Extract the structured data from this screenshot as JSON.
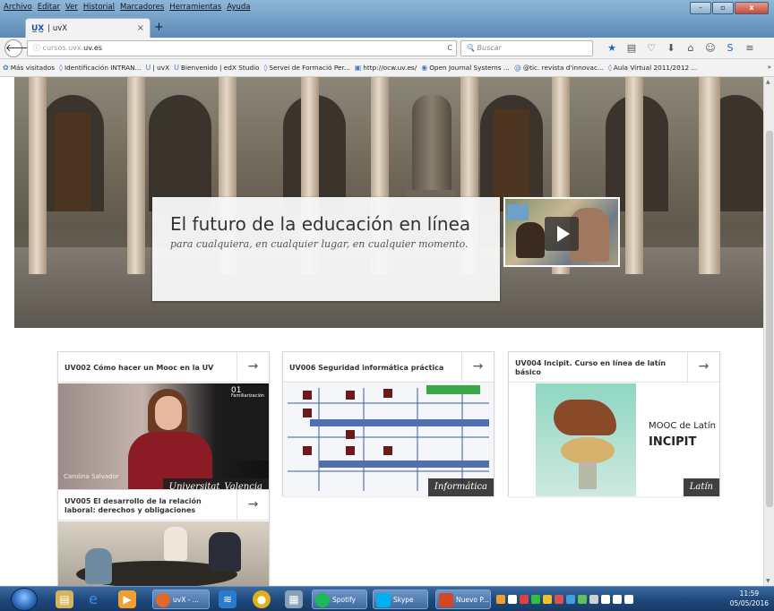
{
  "window": {
    "menus": [
      "Archivo",
      "Editar",
      "Ver",
      "Historial",
      "Marcadores",
      "Herramientas",
      "Ayuda"
    ],
    "controls": {
      "minimize": "–",
      "maximize": "▫",
      "close": "x"
    }
  },
  "tab": {
    "favicon_text": "U̲X̲",
    "label": "| uvX",
    "close": "×",
    "new_tab": "+"
  },
  "navbar": {
    "url_prefix": "cursos.uvx.",
    "url_domain": "uv.es",
    "search_placeholder": "Buscar",
    "reload": "C"
  },
  "bookmarks": [
    {
      "label": "Más visitados",
      "icon": "✿"
    },
    {
      "label": "Identificación INTRAN...",
      "icon": "◊"
    },
    {
      "label": "| uvX",
      "icon": "U"
    },
    {
      "label": "Bienvenido | edX Studio",
      "icon": "U"
    },
    {
      "label": "Servei de Formació Per...",
      "icon": "◊"
    },
    {
      "label": "http://ocw.uv.es/",
      "icon": "▣"
    },
    {
      "label": "Open Journal Systems ...",
      "icon": "◉"
    },
    {
      "label": "@tic. revista d'innovac...",
      "icon": "@"
    },
    {
      "label": "Aula Virtual 2011/2012 ...",
      "icon": "◊"
    }
  ],
  "bookmarks_more": "»",
  "hero": {
    "title": "El futuro de la educación en línea",
    "subtitle": "para cualquiera, en cualquier lugar, en cualquier momento."
  },
  "courses": [
    {
      "title": "UV002 Cómo hacer un Mooc en la UV",
      "tag": "Universitat_Valencia",
      "slide_number": "01",
      "slide_heading": "Familiarización",
      "caption": "Carolina Salvador"
    },
    {
      "title": "UV006 Seguridad informática práctica",
      "tag": "Informática"
    },
    {
      "title": "UV004 Incipit. Curso en línea de latín básico",
      "tag": "Latín",
      "mooc_text": "MOOC de Latín",
      "incipit_text": "INCIPIT"
    },
    {
      "title": "UV005 El desarrollo de la relación laboral: derechos y obligaciones",
      "tag": ""
    }
  ],
  "arrow": "→",
  "taskbar": {
    "items": [
      {
        "label": "uvX - ..."
      },
      {
        "label": "Spotify"
      },
      {
        "label": "Skype"
      },
      {
        "label": "Nuevo P..."
      }
    ],
    "clock_time": "11:59",
    "clock_date": "05/05/2016"
  },
  "colors": {
    "accent": "#1e63c6",
    "card_tag_bg": "#1e1e1e",
    "taskbar": "#1f4a7e"
  }
}
